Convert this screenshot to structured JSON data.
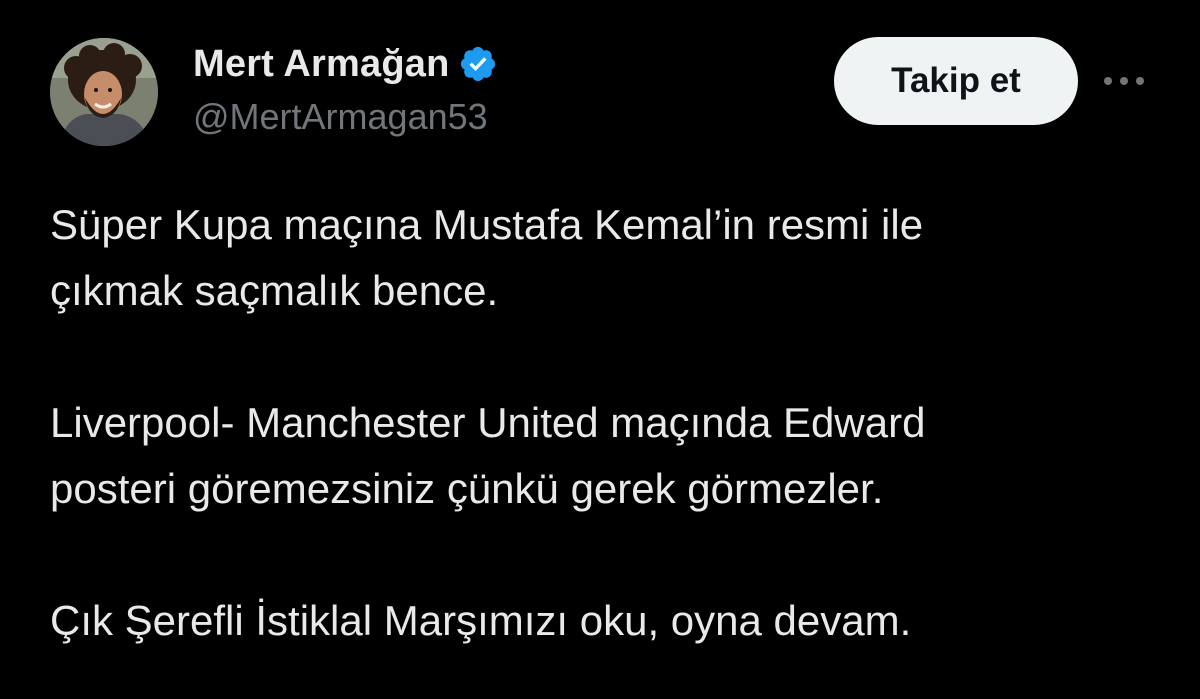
{
  "author": {
    "display_name": "Mert Armağan",
    "handle": "@MertArmagan53",
    "verified": true
  },
  "actions": {
    "follow_label": "Takip et",
    "more_icon": "more-horizontal-icon"
  },
  "tweet": {
    "paragraphs": [
      {
        "lines": [
          "Süper Kupa maçına Mustafa Kemal’in resmi ile",
          "çıkmak saçmalık bence."
        ]
      },
      {
        "lines": [
          "Liverpool- Manchester United maçında Edward",
          "posteri göremezsiniz çünkü gerek görmezler."
        ]
      },
      {
        "lines": [
          "Çık Şerefli İstiklal Marşımızı oku, oyna devam."
        ]
      }
    ]
  },
  "colors": {
    "background": "#000000",
    "text": "#e7e9ea",
    "secondary_text": "#71767b",
    "verified_badge": "#1d9bf0",
    "follow_button_bg": "#eff3f4",
    "follow_button_text": "#0f1419"
  }
}
